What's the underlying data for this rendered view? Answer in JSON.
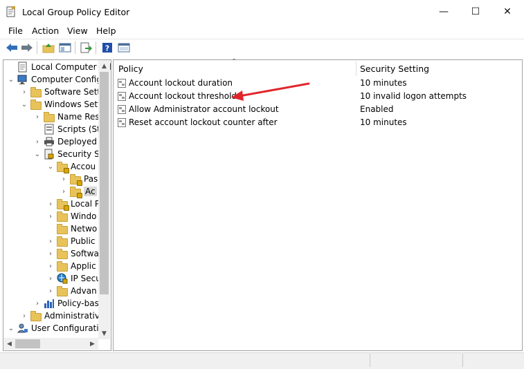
{
  "window": {
    "title": "Local Group Policy Editor",
    "controls": {
      "minimize": "—",
      "maximize": "☐",
      "close": "✕"
    }
  },
  "menu": [
    {
      "label": "File"
    },
    {
      "label": "Action"
    },
    {
      "label": "View"
    },
    {
      "label": "Help"
    }
  ],
  "toolbar": {
    "buttons": [
      "back-icon",
      "forward-icon",
      "up-folder-icon",
      "show-hide-tree-icon",
      "export-list-icon",
      "help-icon",
      "properties-icon"
    ]
  },
  "tree": [
    {
      "label": "Local Computer Polic",
      "level": 0,
      "expander": "",
      "icon": "policy-doc-icon"
    },
    {
      "label": "Computer Config",
      "level": 0,
      "expander": "⌄",
      "icon": "computer-icon"
    },
    {
      "label": "Software Setti",
      "level": 1,
      "expander": "›",
      "icon": "folder-icon"
    },
    {
      "label": "Windows Sett",
      "level": 1,
      "expander": "⌄",
      "icon": "folder-icon"
    },
    {
      "label": "Name Res",
      "level": 2,
      "expander": "›",
      "icon": "folder-icon"
    },
    {
      "label": "Scripts (Sta",
      "level": 2,
      "expander": "",
      "icon": "scripts-icon"
    },
    {
      "label": "Deployed",
      "level": 2,
      "expander": "›",
      "icon": "printer-icon"
    },
    {
      "label": "Security Se",
      "level": 2,
      "expander": "⌄",
      "icon": "security-icon"
    },
    {
      "label": "Accou",
      "level": 3,
      "expander": "⌄",
      "icon": "lock-folder-icon"
    },
    {
      "label": "Pas",
      "level": 4,
      "expander": "›",
      "icon": "lock-folder-icon"
    },
    {
      "label": "Ac",
      "level": 4,
      "expander": "›",
      "icon": "lock-folder-icon",
      "selected": true
    },
    {
      "label": "Local P",
      "level": 3,
      "expander": "›",
      "icon": "lock-folder-icon"
    },
    {
      "label": "Windo",
      "level": 3,
      "expander": "›",
      "icon": "folder-icon"
    },
    {
      "label": "Netwo",
      "level": 3,
      "expander": "",
      "icon": "folder-icon"
    },
    {
      "label": "Public",
      "level": 3,
      "expander": "›",
      "icon": "folder-icon"
    },
    {
      "label": "Softwa",
      "level": 3,
      "expander": "›",
      "icon": "folder-icon"
    },
    {
      "label": "Applic",
      "level": 3,
      "expander": "›",
      "icon": "folder-icon"
    },
    {
      "label": "IP Secu",
      "level": 3,
      "expander": "›",
      "icon": "ip-security-icon"
    },
    {
      "label": "Advan",
      "level": 3,
      "expander": "›",
      "icon": "folder-icon"
    },
    {
      "label": "Policy-bas",
      "level": 2,
      "expander": "›",
      "icon": "chart-icon"
    },
    {
      "label": "Administrative",
      "level": 1,
      "expander": "›",
      "icon": "folder-icon"
    },
    {
      "label": "User Configuratio",
      "level": 0,
      "expander": "⌄",
      "icon": "user-icon"
    }
  ],
  "list": {
    "columns": {
      "policy": "Policy",
      "setting": "Security Setting"
    },
    "rows": [
      {
        "policy": "Account lockout duration",
        "setting": "10 minutes"
      },
      {
        "policy": "Account lockout threshold",
        "setting": "10 invalid logon attempts"
      },
      {
        "policy": "Allow Administrator account lockout",
        "setting": "Enabled"
      },
      {
        "policy": "Reset account lockout counter after",
        "setting": "10 minutes"
      }
    ]
  },
  "annotation": {
    "arrow_color": "#e0262b",
    "points_to": "Account lockout threshold"
  },
  "colors": {
    "folder": "#e8c35a",
    "selection": "#d9d9d9",
    "arrow": "#e0262b"
  }
}
